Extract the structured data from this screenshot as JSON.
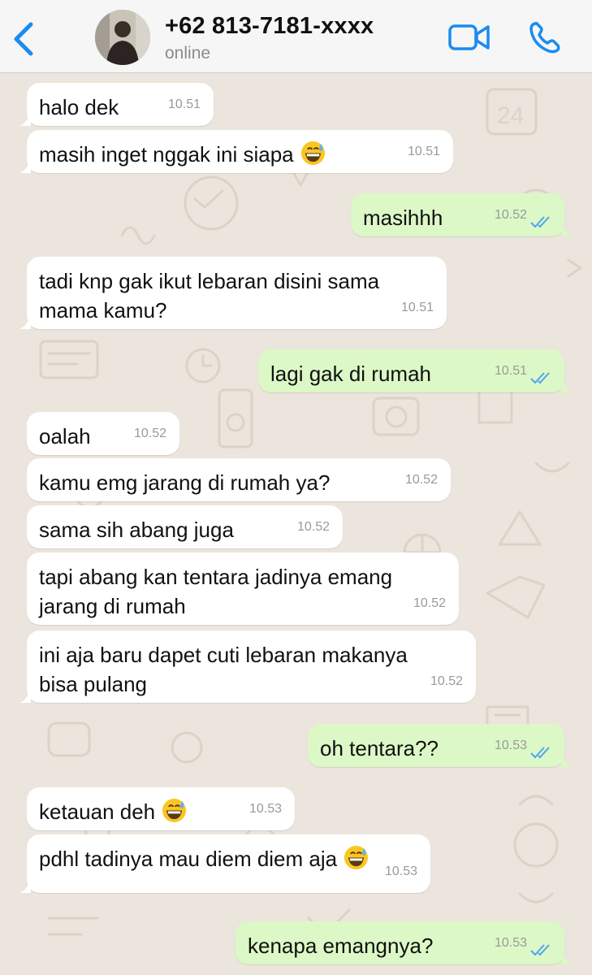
{
  "header": {
    "contact_name": "+62 813-7181-xxxx",
    "status": "online",
    "accent_color": "#1a8cf0"
  },
  "messages": [
    {
      "id": "m1",
      "dir": "in",
      "text": "halo dek",
      "time": "10.51"
    },
    {
      "id": "m2",
      "dir": "in",
      "text": "masih inget nggak ini siapa",
      "emoji": "grinning-sweat-emoji",
      "time": "10.51"
    },
    {
      "id": "m3",
      "dir": "out",
      "text": "masihhh",
      "time": "10.52",
      "read": true
    },
    {
      "id": "m4",
      "dir": "in",
      "lines": [
        "tadi knp gak ikut lebaran disini sama",
        "mama kamu?"
      ],
      "time": "10.51"
    },
    {
      "id": "m5",
      "dir": "out",
      "text": "lagi gak di rumah",
      "time": "10.51",
      "read": true
    },
    {
      "id": "m6",
      "dir": "in",
      "text": "oalah",
      "time": "10.52"
    },
    {
      "id": "m7",
      "dir": "in",
      "text": "kamu emg jarang di rumah ya?",
      "time": "10.52"
    },
    {
      "id": "m8",
      "dir": "in",
      "text": "sama sih abang juga",
      "time": "10.52"
    },
    {
      "id": "m9",
      "dir": "in",
      "lines": [
        "tapi abang kan tentara jadinya emang",
        "jarang di rumah"
      ],
      "time": "10.52"
    },
    {
      "id": "m10",
      "dir": "in",
      "lines": [
        "ini aja baru dapet cuti lebaran makanya",
        "bisa pulang"
      ],
      "time": "10.52"
    },
    {
      "id": "m11",
      "dir": "out",
      "text": "oh tentara??",
      "time": "10.53",
      "read": true
    },
    {
      "id": "m12",
      "dir": "in",
      "text": "ketauan deh",
      "emoji": "grinning-sweat-emoji",
      "time": "10.53"
    },
    {
      "id": "m13",
      "dir": "in",
      "text": "pdhl tadinya mau diem diem aja",
      "emoji": "grinning-sweat-emoji",
      "time": "10.53"
    },
    {
      "id": "m14",
      "dir": "out",
      "text": "kenapa emangnya?",
      "time": "10.53",
      "read": true
    }
  ]
}
